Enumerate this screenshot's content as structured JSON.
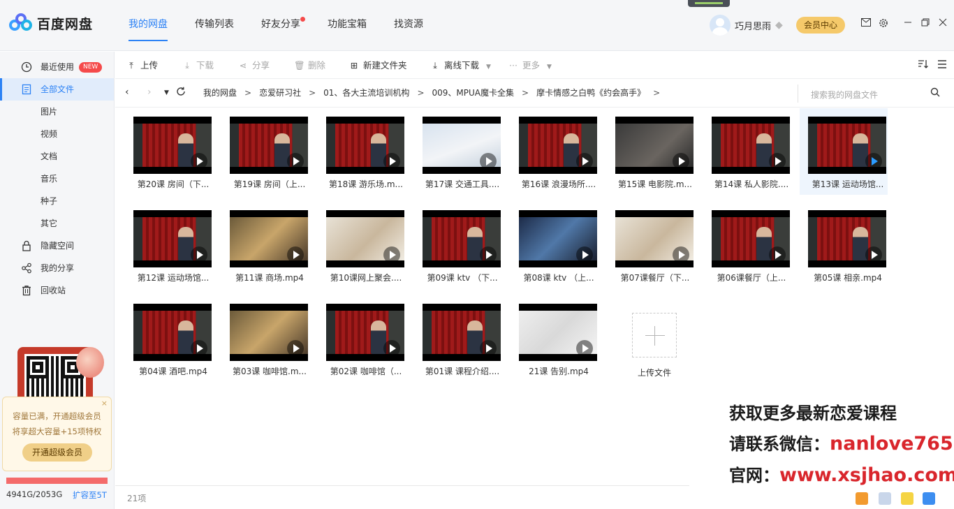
{
  "app": {
    "name": "百度网盘"
  },
  "topnav": {
    "tabs": [
      {
        "label": "我的网盘",
        "active": true
      },
      {
        "label": "传输列表"
      },
      {
        "label": "好友分享",
        "has_dot": true
      },
      {
        "label": "功能宝箱"
      },
      {
        "label": "找资源"
      }
    ]
  },
  "user": {
    "name": "巧月思雨",
    "vip_button": "会员中心"
  },
  "sidebar": {
    "items": [
      {
        "label": "最近使用",
        "icon": "clock-icon",
        "badge": "NEW"
      },
      {
        "label": "全部文件",
        "icon": "file-icon",
        "active": true
      },
      {
        "label": "图片"
      },
      {
        "label": "视频"
      },
      {
        "label": "文档"
      },
      {
        "label": "音乐"
      },
      {
        "label": "种子"
      },
      {
        "label": "其它"
      },
      {
        "label": "隐藏空间",
        "icon": "lock-icon"
      },
      {
        "label": "我的分享",
        "icon": "share-icon"
      },
      {
        "label": "回收站",
        "icon": "trash-icon"
      }
    ],
    "promo": {
      "line1": "容量已满，开通超级会员",
      "line2": "将享超大容量+15项特权",
      "button": "开通超级会员",
      "close": "×"
    },
    "quota": {
      "used": "4941G/2053G",
      "expand": "扩容至5T"
    }
  },
  "toolbar": {
    "upload": "上传",
    "download": "下载",
    "share": "分享",
    "delete": "删除",
    "new_folder": "新建文件夹",
    "offline": "离线下载",
    "more": "更多"
  },
  "breadcrumb": {
    "items": [
      "我的网盘",
      "恋爱研习社",
      "01、各大主流培训机构",
      "009、MPUA魔卡全集",
      "摩卡情感之白鸭《约会高手》"
    ],
    "search_placeholder": "搜索我的网盘文件"
  },
  "files": [
    {
      "name": "第20课 房间（下...",
      "scene": "red"
    },
    {
      "name": "第19课 房间（上...",
      "scene": "red"
    },
    {
      "name": "第18课 游乐场.m...",
      "scene": "red"
    },
    {
      "name": "第17课 交通工具....",
      "scene": "snow"
    },
    {
      "name": "第16课 浪漫场所....",
      "scene": "red"
    },
    {
      "name": "第15课 电影院.m...",
      "scene": "dark"
    },
    {
      "name": "第14课 私人影院....",
      "scene": "red"
    },
    {
      "name": "第13课 运动场馆...",
      "scene": "red",
      "highlight": true
    },
    {
      "name": "第12课 运动场馆...",
      "scene": "red"
    },
    {
      "name": "第11课 商场.mp4",
      "scene": "warm"
    },
    {
      "name": "第10课网上聚会....",
      "scene": "bright"
    },
    {
      "name": "第09课 ktv （下...",
      "scene": "red"
    },
    {
      "name": "第08课 ktv （上...",
      "scene": "blue"
    },
    {
      "name": "第07课餐厅（下...",
      "scene": "bright"
    },
    {
      "name": "第06课餐厅（上...",
      "scene": "red"
    },
    {
      "name": "第05课 相亲.mp4",
      "scene": "red"
    },
    {
      "name": "第04课 酒吧.mp4",
      "scene": "red"
    },
    {
      "name": "第03课 咖啡馆.m...",
      "scene": "warm"
    },
    {
      "name": "第02课 咖啡馆（...",
      "scene": "red"
    },
    {
      "name": "第01课 课程介绍....",
      "scene": "red"
    },
    {
      "name": "21课 告别.mp4",
      "scene": "light"
    }
  ],
  "upload_tile": "上传文件",
  "status": {
    "count": "21项"
  },
  "watermark": {
    "line1": "获取更多最新恋爱课程",
    "line2_prefix": "请联系微信：",
    "line2_value": "nanlove765",
    "line3_prefix": "官网：",
    "line3_value": "www.xsjhao.com"
  },
  "colors": {
    "accent": "#2c82f5",
    "badge": "#f54a4a",
    "watermark_red": "#d9262c"
  }
}
